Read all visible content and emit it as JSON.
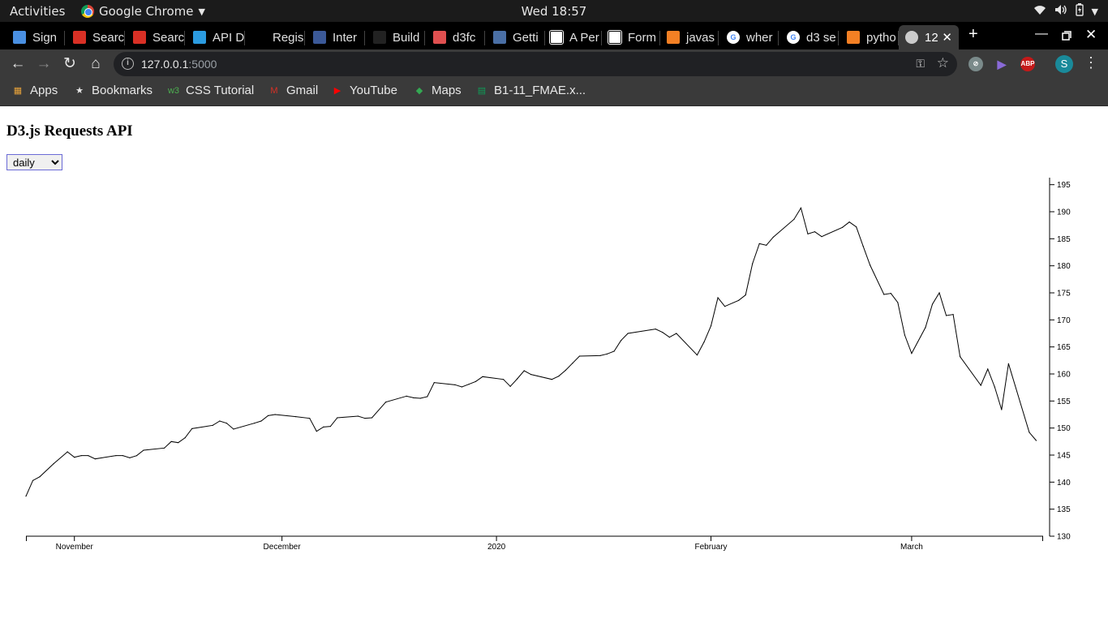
{
  "system_bar": {
    "activities": "Activities",
    "app_name": "Google Chrome",
    "clock": "Wed 18:57"
  },
  "tabs": [
    {
      "title": "Sign",
      "icon": "chat-icon",
      "color": "#4a90e2"
    },
    {
      "title": "Searc",
      "icon": "gmail-icon",
      "color": "#d93025"
    },
    {
      "title": "Searc",
      "icon": "gmail-icon",
      "color": "#d93025"
    },
    {
      "title": "API D",
      "icon": "api-icon",
      "color": "#2b9be0"
    },
    {
      "title": "Regis",
      "icon": "blank-icon",
      "color": "#000000"
    },
    {
      "title": "Inter",
      "icon": "tds-icon",
      "color": "#3b5998"
    },
    {
      "title": "Build",
      "icon": "sl-icon",
      "color": "#222222"
    },
    {
      "title": "d3fc",
      "icon": "d3fc-icon",
      "color": "#e05050"
    },
    {
      "title": "Getti",
      "icon": "dsfc-icon",
      "color": "#4a6fa5"
    },
    {
      "title": "A Per",
      "icon": "codepen-icon",
      "color": "#ffffff"
    },
    {
      "title": "Form",
      "icon": "codepen-icon",
      "color": "#ffffff"
    },
    {
      "title": "javas",
      "icon": "stackoverflow-icon",
      "color": "#f48024"
    },
    {
      "title": "wher",
      "icon": "google-icon",
      "color": "#4285f4"
    },
    {
      "title": "d3 se",
      "icon": "google-icon",
      "color": "#4285f4"
    },
    {
      "title": "pytho",
      "icon": "stackoverflow-icon",
      "color": "#f48024"
    },
    {
      "title": "12",
      "icon": "globe-icon",
      "color": "#cccccc",
      "active": true
    }
  ],
  "toolbar": {
    "url_host": "127.0.0.1",
    "url_port": ":5000"
  },
  "bookmarks": [
    {
      "label": "Apps",
      "icon": "apps-grid-icon"
    },
    {
      "label": "Bookmarks",
      "icon": "star-icon"
    },
    {
      "label": "CSS Tutorial",
      "icon": "w3-icon"
    },
    {
      "label": "Gmail",
      "icon": "gmail-icon"
    },
    {
      "label": "YouTube",
      "icon": "youtube-icon"
    },
    {
      "label": "Maps",
      "icon": "maps-icon"
    },
    {
      "label": "B1-11_FMAE.x...",
      "icon": "sheets-icon"
    }
  ],
  "page": {
    "title": "D3.js Requests API",
    "select_value": "daily",
    "select_options": [
      "daily"
    ]
  },
  "chart_data": {
    "type": "line",
    "title": "",
    "xlabel": "",
    "ylabel": "",
    "y_axis_side": "right",
    "ylim": [
      130,
      196
    ],
    "yticks": [
      130,
      135,
      140,
      145,
      150,
      155,
      160,
      165,
      170,
      175,
      180,
      185,
      190,
      195
    ],
    "xlim": [
      "2019-10-25",
      "2020-03-20"
    ],
    "xticks": [
      {
        "date": "2019-11-01",
        "label": "November"
      },
      {
        "date": "2019-12-01",
        "label": "December"
      },
      {
        "date": "2020-01-01",
        "label": "2020"
      },
      {
        "date": "2020-02-01",
        "label": "February"
      },
      {
        "date": "2020-03-01",
        "label": "March"
      }
    ],
    "series": [
      {
        "color": "#000000",
        "points": [
          [
            "2019-10-25",
            137.4
          ],
          [
            "2019-10-26",
            140.3
          ],
          [
            "2019-10-27",
            141.0
          ],
          [
            "2019-10-29",
            143.4
          ],
          [
            "2019-10-31",
            145.6
          ],
          [
            "2019-11-01",
            144.6
          ],
          [
            "2019-11-02",
            144.9
          ],
          [
            "2019-11-03",
            144.9
          ],
          [
            "2019-11-04",
            144.3
          ],
          [
            "2019-11-07",
            144.9
          ],
          [
            "2019-11-08",
            144.9
          ],
          [
            "2019-11-09",
            144.5
          ],
          [
            "2019-11-10",
            144.9
          ],
          [
            "2019-11-11",
            145.9
          ],
          [
            "2019-11-14",
            146.3
          ],
          [
            "2019-11-15",
            147.5
          ],
          [
            "2019-11-16",
            147.3
          ],
          [
            "2019-11-17",
            148.2
          ],
          [
            "2019-11-18",
            149.9
          ],
          [
            "2019-11-21",
            150.5
          ],
          [
            "2019-11-22",
            151.3
          ],
          [
            "2019-11-23",
            150.9
          ],
          [
            "2019-11-24",
            149.8
          ],
          [
            "2019-11-27",
            150.9
          ],
          [
            "2019-11-28",
            151.3
          ],
          [
            "2019-11-29",
            152.3
          ],
          [
            "2019-11-30",
            152.5
          ],
          [
            "2019-12-03",
            152.1
          ],
          [
            "2019-12-05",
            151.8
          ],
          [
            "2019-12-06",
            149.4
          ],
          [
            "2019-12-07",
            150.2
          ],
          [
            "2019-12-08",
            150.3
          ],
          [
            "2019-12-09",
            151.9
          ],
          [
            "2019-12-12",
            152.2
          ],
          [
            "2019-12-13",
            151.8
          ],
          [
            "2019-12-14",
            151.9
          ],
          [
            "2019-12-16",
            154.8
          ],
          [
            "2019-12-19",
            155.9
          ],
          [
            "2019-12-20",
            155.6
          ],
          [
            "2019-12-21",
            155.5
          ],
          [
            "2019-12-22",
            155.8
          ],
          [
            "2019-12-23",
            158.4
          ],
          [
            "2019-12-26",
            158.0
          ],
          [
            "2019-12-27",
            157.6
          ],
          [
            "2019-12-28",
            158.1
          ],
          [
            "2019-12-29",
            158.6
          ],
          [
            "2019-12-30",
            159.5
          ],
          [
            "2020-01-02",
            159.0
          ],
          [
            "2020-01-03",
            157.7
          ],
          [
            "2020-01-04",
            159.1
          ],
          [
            "2020-01-05",
            160.6
          ],
          [
            "2020-01-06",
            159.9
          ],
          [
            "2020-01-09",
            159.0
          ],
          [
            "2020-01-10",
            159.6
          ],
          [
            "2020-01-11",
            160.7
          ],
          [
            "2020-01-12",
            162.0
          ],
          [
            "2020-01-13",
            163.3
          ],
          [
            "2020-01-16",
            163.4
          ],
          [
            "2020-01-17",
            163.7
          ],
          [
            "2020-01-18",
            164.2
          ],
          [
            "2020-01-19",
            166.2
          ],
          [
            "2020-01-20",
            167.5
          ],
          [
            "2020-01-24",
            168.3
          ],
          [
            "2020-01-25",
            167.7
          ],
          [
            "2020-01-26",
            166.8
          ],
          [
            "2020-01-27",
            167.5
          ],
          [
            "2020-01-30",
            163.5
          ],
          [
            "2020-01-31",
            165.9
          ],
          [
            "2020-02-01",
            168.9
          ],
          [
            "2020-02-02",
            174.1
          ],
          [
            "2020-02-03",
            172.5
          ],
          [
            "2020-02-05",
            173.6
          ],
          [
            "2020-02-06",
            174.6
          ],
          [
            "2020-02-07",
            180.4
          ],
          [
            "2020-02-08",
            184.1
          ],
          [
            "2020-02-09",
            183.8
          ],
          [
            "2020-02-10",
            185.3
          ],
          [
            "2020-02-13",
            188.6
          ],
          [
            "2020-02-14",
            190.7
          ],
          [
            "2020-02-15",
            185.9
          ],
          [
            "2020-02-16",
            186.3
          ],
          [
            "2020-02-17",
            185.4
          ],
          [
            "2020-02-20",
            187.1
          ],
          [
            "2020-02-21",
            188.1
          ],
          [
            "2020-02-22",
            187.2
          ],
          [
            "2020-02-23",
            183.6
          ],
          [
            "2020-02-24",
            180.1
          ],
          [
            "2020-02-26",
            174.7
          ],
          [
            "2020-02-27",
            174.9
          ],
          [
            "2020-02-28",
            173.2
          ],
          [
            "2020-02-29",
            167.2
          ],
          [
            "2020-03-01",
            163.8
          ],
          [
            "2020-03-03",
            168.6
          ],
          [
            "2020-03-04",
            172.9
          ],
          [
            "2020-03-05",
            175.0
          ],
          [
            "2020-03-06",
            170.8
          ],
          [
            "2020-03-07",
            171.0
          ],
          [
            "2020-03-08",
            163.2
          ],
          [
            "2020-03-11",
            157.9
          ],
          [
            "2020-03-12",
            160.9
          ],
          [
            "2020-03-13",
            157.6
          ],
          [
            "2020-03-14",
            153.4
          ],
          [
            "2020-03-15",
            161.9
          ],
          [
            "2020-03-18",
            149.2
          ],
          [
            "2020-03-19",
            147.7
          ]
        ]
      }
    ]
  }
}
